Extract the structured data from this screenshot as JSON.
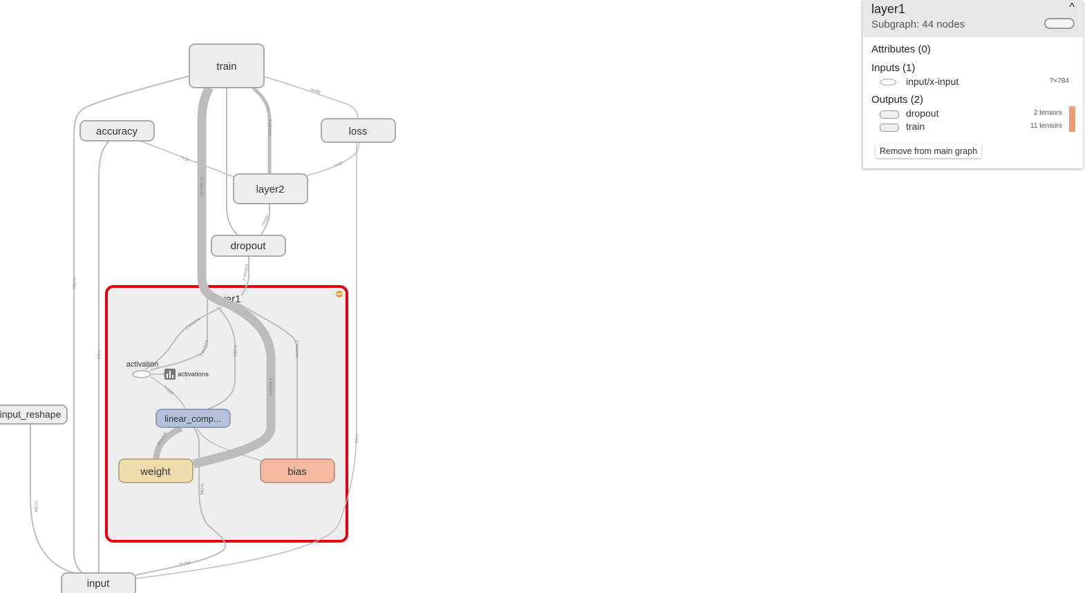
{
  "graph": {
    "nodes": {
      "train": "train",
      "accuracy": "accuracy",
      "loss": "loss",
      "layer2": "layer2",
      "dropout": "dropout",
      "layer1": "layer1",
      "activation": "activation",
      "activations": "activations",
      "linear_comp": "linear_comp...",
      "weight": "weight",
      "bias": "bias",
      "input_reshape": "input_reshape",
      "input": "input"
    },
    "edge_labels": {
      "train_layer1": "11 tensors",
      "layer2_train": "6 tensors",
      "loss_train": "scalar",
      "accuracy_layer2": "?×10",
      "loss_layer2": "?×10",
      "dropout_layer2": "?×500",
      "dropout_layer1": "2 tensors",
      "layer1_activation": "2 tensors",
      "layer1_act2": "2 tensors",
      "linear_mid": "?×500",
      "weight_train": "4 tensors",
      "bias_train": "2 tensors",
      "act_linear": "?×500",
      "linear_weight": "784×500",
      "linear_input": "?×784",
      "reshape_input": "?×784",
      "input_layer1": "?×784",
      "loss_input": "?×10",
      "accuracy_input": "?×10",
      "train_input": "?×784"
    },
    "colors": {
      "selected_border": "#e8000b",
      "linear_fill": "#b4c1dd",
      "weight_fill": "#f0dcaa",
      "bias_fill": "#f4b9a0",
      "node_fill": "#eeeeee",
      "expand_badge": "#f09c3c"
    }
  },
  "info_card": {
    "title": "layer1",
    "subtitle": "Subgraph: 44 nodes",
    "collapse_icon": "^",
    "attributes_header": "Attributes (0)",
    "inputs_header": "Inputs (1)",
    "inputs": [
      {
        "name": "input/x-input",
        "meta": "?×784"
      }
    ],
    "outputs_header": "Outputs (2)",
    "outputs": [
      {
        "name": "dropout",
        "meta": "2 tensors"
      },
      {
        "name": "train",
        "meta": "11 tensors"
      }
    ],
    "remove_button": "Remove from main graph"
  }
}
